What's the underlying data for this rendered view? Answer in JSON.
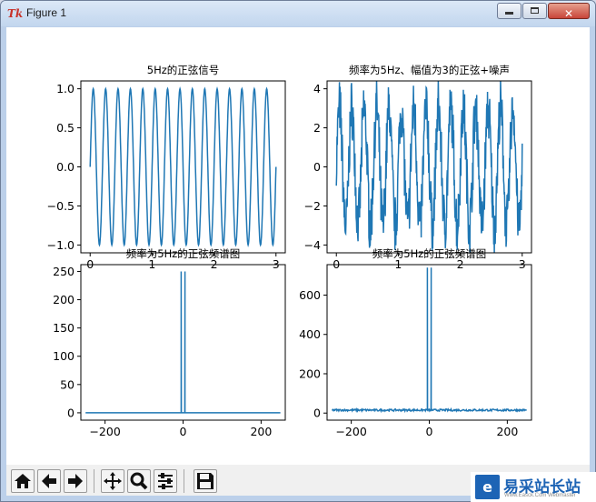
{
  "window": {
    "title": "Figure 1",
    "icon": "tk-feather-icon"
  },
  "toolbar": {
    "buttons": [
      "home-icon",
      "back-arrow-icon",
      "forward-arrow-icon",
      "pan-icon",
      "zoom-icon",
      "configure-subplots-icon",
      "save-icon"
    ]
  },
  "watermark": {
    "text": "易采站长站",
    "url": "Www.Easck.Com Webmaster"
  },
  "colors": {
    "line": "#1f77b4"
  },
  "chart_data": [
    {
      "type": "line",
      "title": "5Hz的正弦信号",
      "xlabel": "",
      "ylabel": "",
      "xlim": [
        -0.15,
        3.15
      ],
      "ylim": [
        -1.1,
        1.1
      ],
      "xticks": [
        0,
        1,
        2,
        3
      ],
      "yticks": [
        -1.0,
        -0.5,
        0.0,
        0.5,
        1.0
      ],
      "yticklabels": [
        "−1.0",
        "−0.5",
        "0.0",
        "0.5",
        "1.0"
      ],
      "series": [
        {
          "function": "sin(2*pi*5*t)",
          "t_range": [
            0,
            3
          ]
        }
      ]
    },
    {
      "type": "line",
      "title": "频率为5Hz、幅值为3的正弦+噪声",
      "xlabel": "",
      "ylabel": "",
      "xlim": [
        -0.15,
        3.15
      ],
      "ylim": [
        -4.4,
        4.4
      ],
      "xticks": [
        0,
        1,
        2,
        3
      ],
      "yticks": [
        -4,
        -2,
        0,
        2,
        4
      ],
      "yticklabels": [
        "−4",
        "−2",
        "0",
        "2",
        "4"
      ],
      "series": [
        {
          "function": "3*sin(2*pi*5*t) + noise",
          "t_range": [
            0,
            3
          ]
        }
      ]
    },
    {
      "type": "line",
      "title": "频率为5Hz的正弦频谱图",
      "xlabel": "",
      "ylabel": "",
      "xlim": [
        -262,
        262
      ],
      "ylim": [
        -13,
        262
      ],
      "xticks": [
        -200,
        0,
        200
      ],
      "yticks": [
        0,
        50,
        100,
        150,
        200,
        250
      ],
      "xticklabels": [
        "−200",
        "0",
        "200"
      ],
      "series": [
        {
          "baseline": 0,
          "peaks": [
            {
              "x": -5,
              "y": 250
            },
            {
              "x": 5,
              "y": 250
            }
          ]
        }
      ]
    },
    {
      "type": "line",
      "title": "频率为5Hz的正弦频谱图",
      "xlabel": "",
      "ylabel": "",
      "xlim": [
        -262,
        262
      ],
      "ylim": [
        -36,
        755
      ],
      "xticks": [
        -200,
        0,
        200
      ],
      "yticks": [
        0,
        200,
        400,
        600
      ],
      "xticklabels": [
        "−200",
        "0",
        "200"
      ],
      "series": [
        {
          "baseline": 15,
          "noise_amplitude": 10,
          "peaks": [
            {
              "x": -5,
              "y": 740
            },
            {
              "x": 5,
              "y": 740
            }
          ]
        }
      ]
    }
  ]
}
